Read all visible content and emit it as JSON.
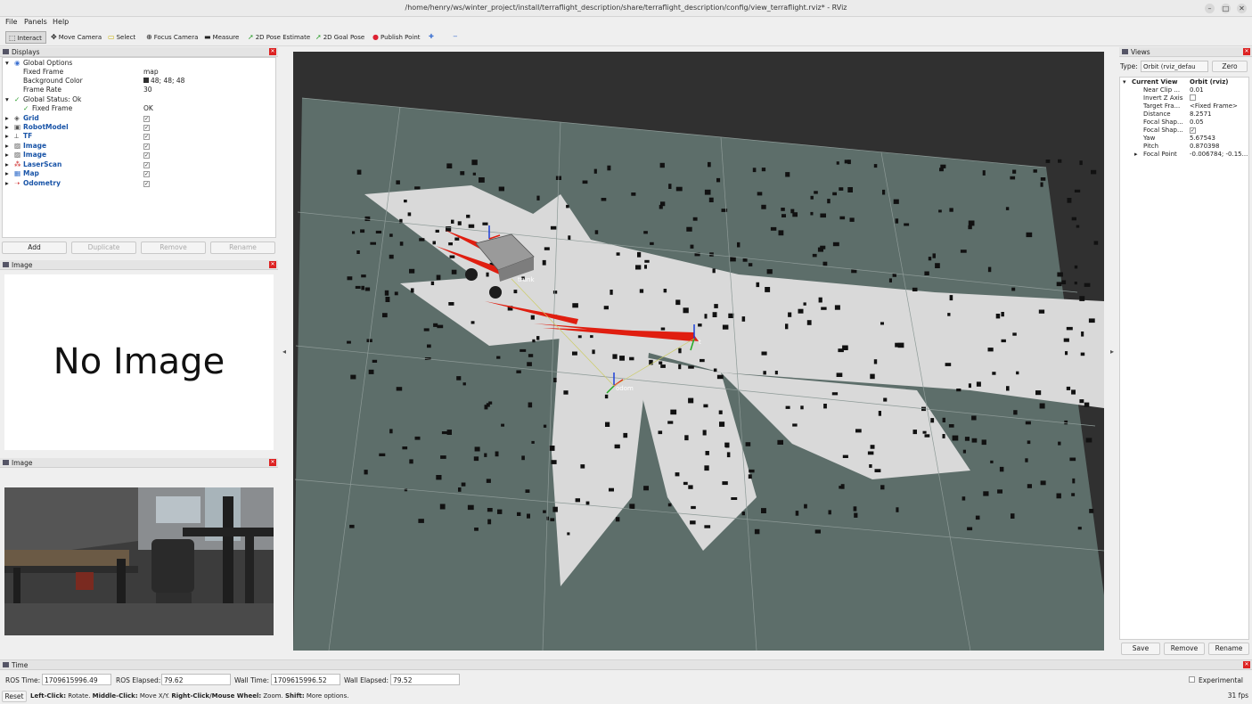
{
  "window": {
    "title": "/home/henry/ws/winter_project/install/terraflight_description/share/terraflight_description/config/view_terraflight.rviz* - RViz",
    "minimize": "–",
    "maximize": "□",
    "close": "✕"
  },
  "menu": {
    "file": "File",
    "panels": "Panels",
    "help": "Help"
  },
  "toolbar": {
    "interact": "Interact",
    "move_camera": "Move Camera",
    "select": "Select",
    "focus_camera": "Focus Camera",
    "measure": "Measure",
    "pose_estimate": "2D Pose Estimate",
    "goal_pose": "2D Goal Pose",
    "publish_point": "Publish Point",
    "plus": "✚",
    "minus": "−"
  },
  "displays": {
    "title": "Displays",
    "global_options": "Global Options",
    "fixed_frame_label": "Fixed Frame",
    "fixed_frame_value": "map",
    "background_color_label": "Background Color",
    "background_color_value": "48; 48; 48",
    "background_color_hex": "#303030",
    "frame_rate_label": "Frame Rate",
    "frame_rate_value": "30",
    "global_status": "Global Status: Ok",
    "fixed_frame_status_label": "Fixed Frame",
    "fixed_frame_status_value": "OK",
    "items": [
      {
        "label": "Grid",
        "icon": "grid-icon"
      },
      {
        "label": "RobotModel",
        "icon": "robot-icon"
      },
      {
        "label": "TF",
        "icon": "tf-icon"
      },
      {
        "label": "Image",
        "icon": "image-icon"
      },
      {
        "label": "Image",
        "icon": "image-icon"
      },
      {
        "label": "LaserScan",
        "icon": "laserscan-icon"
      },
      {
        "label": "Map",
        "icon": "map-icon"
      },
      {
        "label": "Odometry",
        "icon": "odometry-icon"
      }
    ],
    "check": "✓",
    "buttons": {
      "add": "Add",
      "duplicate": "Duplicate",
      "remove": "Remove",
      "rename": "Rename"
    }
  },
  "image_panel_1": {
    "title": "Image",
    "placeholder": "No Image"
  },
  "image_panel_2": {
    "title": "Image"
  },
  "viewport": {
    "frame_labels": {
      "base": "trunk",
      "goal": "t",
      "odom": "odom"
    },
    "map_free_color": "#d9d9d9",
    "map_unknown_color": "#5d6e6a",
    "obstacle_color": "#111111",
    "arrow_color": "#e01e10"
  },
  "views": {
    "title": "Views",
    "type_label": "Type:",
    "type_value": "Orbit (rviz_defau",
    "zero_button": "Zero",
    "current_view_label": "Current View",
    "current_view_value": "Orbit (rviz)",
    "props": [
      {
        "name": "Near Clip ...",
        "value": "0.01"
      },
      {
        "name": "Invert Z Axis",
        "value": ""
      },
      {
        "name": "Target Fra...",
        "value": "<Fixed Frame>"
      },
      {
        "name": "Distance",
        "value": "8.2571"
      },
      {
        "name": "Focal Shap...",
        "value": "0.05"
      },
      {
        "name": "Focal Shap...",
        "value": "✓"
      },
      {
        "name": "Yaw",
        "value": "5.67543"
      },
      {
        "name": "Pitch",
        "value": "0.870398"
      },
      {
        "name": "Focal Point",
        "value": "-0.006784; -0.15..."
      }
    ],
    "buttons": {
      "save": "Save",
      "remove": "Remove",
      "rename": "Rename"
    }
  },
  "time": {
    "title": "Time",
    "ros_time_label": "ROS Time:",
    "ros_time_value": "1709615996.49",
    "ros_elapsed_label": "ROS Elapsed:",
    "ros_elapsed_value": "79.62",
    "wall_time_label": "Wall Time:",
    "wall_time_value": "1709615996.52",
    "wall_elapsed_label": "Wall Elapsed:",
    "wall_elapsed_value": "79.52",
    "experimental": "Experimental",
    "reset": "Reset",
    "hint_lclick": "Left-Click:",
    "hint_lclick_text": " Rotate. ",
    "hint_mclick": "Middle-Click:",
    "hint_mclick_text": " Move X/Y. ",
    "hint_rclick": "Right-Click/Mouse Wheel:",
    "hint_rclick_text": " Zoom. ",
    "hint_shift": "Shift:",
    "hint_shift_text": " More options.",
    "fps": "31 fps"
  }
}
